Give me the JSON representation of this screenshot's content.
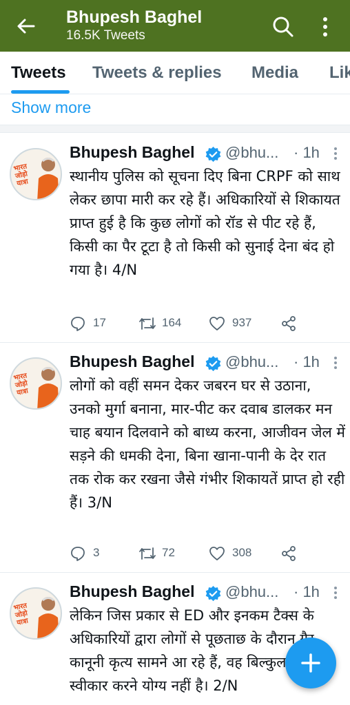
{
  "header": {
    "title": "Bhupesh Baghel",
    "subtitle": "16.5K Tweets",
    "bar_color": "#4e7221",
    "back_icon": "arrow-left-icon",
    "search_icon": "search-icon",
    "more_icon": "vertical-dots-icon"
  },
  "tabs": [
    {
      "label": "Tweets",
      "active": true
    },
    {
      "label": "Tweets & replies",
      "active": false
    },
    {
      "label": "Media",
      "active": false
    },
    {
      "label": "Lik",
      "active": false
    }
  ],
  "show_more": "Show more",
  "avatar_logo_text": "भारत जोड़ो यात्रा",
  "tweets": [
    {
      "name": "Bhupesh Baghel",
      "handle": "@bhu...",
      "time": "· 1h",
      "text": "स्थानीय पुलिस को सूचना दिए बिना CRPF को साथ लेकर छापा मारी  कर रहे हैं। अधिकारियों से शिकायत प्राप्त हुई है कि कुछ लोगों को रॉड से पीट रहे हैं, किसी का पैर टूटा है तो किसी को सुनाई देना बंद हो गया है। 4/N",
      "replies": "17",
      "retweets": "164",
      "likes": "937"
    },
    {
      "name": "Bhupesh Baghel",
      "handle": "@bhu...",
      "time": "· 1h",
      "text": "लोगों को वहीं समन देकर जबरन घर से उठाना, उनको मुर्गा बनाना, मार-पीट कर दवाब डालकर मन चाह बयान दिलवाने को बाध्य करना, आजीवन जेल में सड़ने की धमकी देना, बिना खाना-पानी के देर रात तक रोक कर रखना जैसे गंभीर शिकायतें प्राप्त हो रही हैं। 3/N",
      "replies": "3",
      "retweets": "72",
      "likes": "308"
    },
    {
      "name": "Bhupesh Baghel",
      "handle": "@bhu...",
      "time": "· 1h",
      "text": "लेकिन जिस प्रकार से ED और इनकम टैक्स के अधिकारियों द्वारा लोगों से पूछताछ के दौरान गैर कानूनी कृत्य सामने आ रहे हैं, वह बिल्कुल भी स्वीकार करने योग्य नहीं है। 2/N"
    }
  ],
  "fab_icon": "plus-icon",
  "accent_color": "#1d9bf0"
}
